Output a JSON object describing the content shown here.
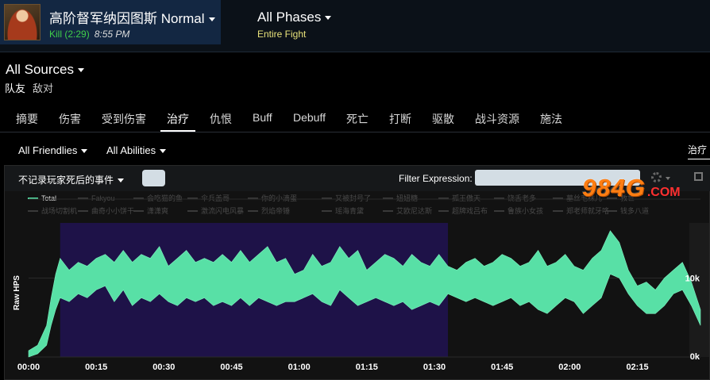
{
  "fight": {
    "boss_name": "高阶督军纳因图斯 Normal",
    "kill_status": "Kill (2:29)",
    "kill_time": "8:55 PM"
  },
  "phase": {
    "title": "All Phases",
    "subtitle": "Entire Fight"
  },
  "sources": {
    "title": "All Sources",
    "tabs": [
      "队友",
      "敌对"
    ]
  },
  "tabs": [
    "摘要",
    "伤害",
    "受到伤害",
    "治疗",
    "仇恨",
    "Buff",
    "Debuff",
    "死亡",
    "打断",
    "驱散",
    "战斗资源",
    "施法"
  ],
  "active_tab_index": 3,
  "filters": {
    "friendlies": "All Friendlies",
    "abilities": "All Abilities",
    "mode_label": "治疗"
  },
  "panel": {
    "death_filter": "不记录玩家死后的事件",
    "filter_expression_label": "Filter Expression:",
    "filter_expression_value": ""
  },
  "watermark": {
    "text": "984G",
    "suffix": ".COM"
  },
  "colors": {
    "series_fill": "#58e0a6",
    "phase_highlight": "#1e1248",
    "kill": "#3fce4a",
    "active_phase_sub": "#e8e27a"
  },
  "chart_data": {
    "type": "area",
    "title": "",
    "ylabel": "Raw HPS",
    "xlabel": "",
    "x_ticks": [
      "00:00",
      "00:15",
      "00:30",
      "00:45",
      "01:00",
      "01:15",
      "01:30",
      "01:45",
      "02:00",
      "02:15"
    ],
    "y_ticks": [
      "0k",
      "10k"
    ],
    "ylim": [
      0,
      21000
    ],
    "xlim_seconds": [
      0,
      149
    ],
    "highlight_range_seconds": [
      7,
      93
    ],
    "grid": true,
    "legend_position": "top",
    "legend": {
      "row1": [
        "Total",
        "Fakyou",
        "会吃猫的鱼",
        "伞兵盖哥",
        "你的小滴蛋",
        "又被封号了",
        "妞妞糖",
        "孤王傲天",
        "饶舌老多",
        "墓丝毛袜儿",
        "救世"
      ],
      "row2": [
        "战场切割机",
        "曲奇小小饼干",
        "潇潇爽",
        "激流闪电风暴",
        "烈焰帝锤",
        "瑶海青黛",
        "艾欧尼达斯",
        "超牌戏吕布",
        "鲁族小女孩",
        "郑老师就牙咯",
        "钱多八道"
      ]
    },
    "series": [
      {
        "name": "Total",
        "x": [
          0,
          2,
          4,
          5,
          6,
          7,
          9,
          11,
          13,
          15,
          17,
          19,
          21,
          23,
          25,
          27,
          29,
          31,
          33,
          35,
          37,
          39,
          41,
          43,
          45,
          47,
          49,
          51,
          53,
          55,
          57,
          59,
          61,
          63,
          65,
          67,
          69,
          71,
          73,
          75,
          77,
          79,
          81,
          83,
          85,
          87,
          89,
          91,
          93,
          95,
          97,
          99,
          101,
          103,
          105,
          107,
          109,
          111,
          113,
          115,
          117,
          119,
          121,
          123,
          125,
          127,
          129,
          131,
          133,
          135,
          137,
          139,
          141,
          143,
          145,
          147,
          149
        ],
        "upper": [
          800,
          1500,
          4000,
          7500,
          10500,
          12500,
          11000,
          12000,
          11500,
          12500,
          13000,
          12000,
          13500,
          12000,
          13000,
          12500,
          14000,
          11500,
          12500,
          13500,
          12000,
          12500,
          12000,
          13000,
          12000,
          13500,
          12000,
          13000,
          14000,
          12000,
          12500,
          10500,
          11000,
          13000,
          11500,
          12000,
          14000,
          12500,
          13500,
          11000,
          12000,
          13000,
          12500,
          11500,
          13000,
          12000,
          11500,
          13000,
          11500,
          11000,
          12000,
          12500,
          11500,
          12000,
          13000,
          12500,
          11500,
          12000,
          13500,
          11500,
          12000,
          13000,
          11500,
          11000,
          12500,
          13500,
          16000,
          14500,
          11000,
          9000,
          9500,
          8500,
          10000,
          11000,
          12000,
          9500,
          6000
        ],
        "lower": [
          0,
          400,
          1500,
          4000,
          6000,
          7500,
          7000,
          8000,
          7500,
          8500,
          9000,
          7000,
          8500,
          6500,
          7500,
          7000,
          8000,
          7000,
          6500,
          7500,
          7000,
          7500,
          6500,
          7000,
          6500,
          7500,
          6500,
          7500,
          7000,
          6500,
          7000,
          7000,
          7500,
          8000,
          7000,
          6500,
          8500,
          7500,
          6500,
          7000,
          7500,
          7000,
          6500,
          7000,
          6000,
          6500,
          7000,
          6500,
          8000,
          7500,
          7000,
          7500,
          7000,
          6500,
          7000,
          7500,
          6500,
          7000,
          6000,
          5500,
          6500,
          7500,
          7000,
          5500,
          6500,
          7500,
          10500,
          10000,
          8000,
          6500,
          5500,
          5500,
          6500,
          8000,
          8500,
          6500,
          4000
        ]
      }
    ]
  }
}
